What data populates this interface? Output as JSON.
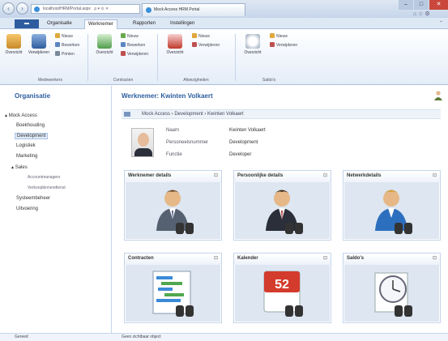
{
  "browser": {
    "address": "localhost/HRM/Portal.aspx",
    "address_tools": "ρ ▾ ⊙ ✕",
    "tab_title": "Mock Access HRM Portal",
    "win_min": "–",
    "win_max": "□",
    "win_close": "✕",
    "right_icons": "⌂ ☆ ⚙"
  },
  "ribbon": {
    "file_label": "",
    "tabs": [
      "Organisatie",
      "Werknemer",
      "Rapporten",
      "Instellingen"
    ],
    "active_tab": 1,
    "groups": [
      {
        "label": "Medewerkers"
      },
      {
        "label": "Contracten"
      },
      {
        "label": "Afwezigheden"
      },
      {
        "label": "Saldo's"
      }
    ],
    "buttons": {
      "overzicht1": "Overzicht",
      "verwijderen": "Verwijderen",
      "nieuw1": "Nieuw",
      "bewerken1": "Bewerken",
      "printen": "Printen",
      "overzicht2": "Overzicht",
      "nieuw2": "Nieuw",
      "bewerken2": "Bewerken",
      "verwijder2": "Verwijderen",
      "overzicht3": "Overzicht",
      "nieuw3": "Nieuw",
      "verwijder3": "Verwijderen",
      "overzicht4": "Overzicht",
      "nieuw4": "Nieuw",
      "verwijder4": "Verwijderen"
    }
  },
  "sidebar": {
    "title": "Organisatie",
    "items": [
      {
        "label": "Mock Access"
      },
      {
        "label": "Boekhouding"
      },
      {
        "label": "Development"
      },
      {
        "label": "Logistiek"
      },
      {
        "label": "Marketing"
      },
      {
        "label": "Sales"
      },
      {
        "label": "Accountmanagers"
      },
      {
        "label": "Verkoopbinnendienst"
      },
      {
        "label": "Systeembeheer"
      },
      {
        "label": "Uitvoering"
      }
    ],
    "footer": "Gereed"
  },
  "main": {
    "title": "Werknemer: Kwinten Volkaert",
    "breadcrumb": "Mock Access  ›  Development  ›  Kwinten Volkaert",
    "info": [
      {
        "key": "Naam",
        "value": "Kwinten Volkaert"
      },
      {
        "key": "Personeelsnummer",
        "value": "Development"
      },
      {
        "key": "Functie",
        "value": "Developer"
      }
    ],
    "tiles": [
      {
        "title": "Werknemer details",
        "icon": "person-binoculars-icon"
      },
      {
        "title": "Persoonlijke details",
        "icon": "person-tie-binoculars-icon"
      },
      {
        "title": "Netwerkdetails",
        "icon": "person-blue-binoculars-icon"
      },
      {
        "title": "Contracten",
        "icon": "chart-binoculars-icon"
      },
      {
        "title": "Kalender",
        "icon": "calendar-binoculars-icon"
      },
      {
        "title": "Saldo's",
        "icon": "clock-binoculars-icon"
      }
    ],
    "calendar_day": "52",
    "tile_glyph": "⊡",
    "status": "Geen zichtbaar object"
  }
}
